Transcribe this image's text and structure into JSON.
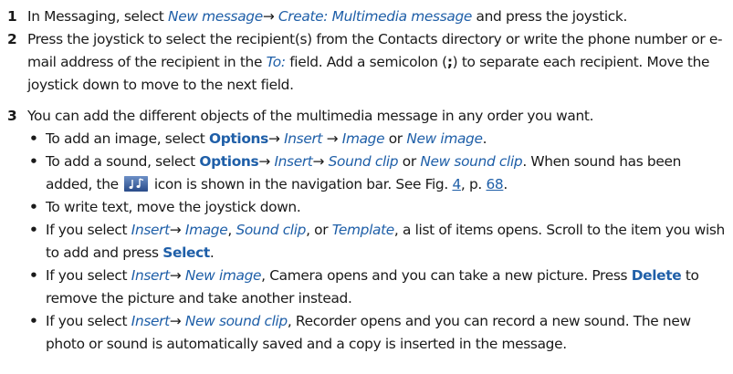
{
  "step1": {
    "num": "1",
    "t1": "In Messaging, select ",
    "ui1": "New message",
    "a1": "→ ",
    "ui2": "Create: Multimedia message",
    "t2": " and press the joystick."
  },
  "step2": {
    "num": "2",
    "t1": "Press the joystick to select the recipient(s) from the Contacts directory or write the phone number or e-mail address of the recipient in the ",
    "ui1": "To:",
    "t2": " field. Add a semicolon (",
    "semi": ";",
    "t3": ") to separate each recipient. Move the joystick down to move to the next field."
  },
  "step3": {
    "num": "3",
    "intro": "You can add the different objects of the multimedia message in any order you want.",
    "b1": {
      "t1": "To add an image, select ",
      "cmd1": "Options",
      "a1": "→ ",
      "ui1": "Insert",
      "a2": " → ",
      "ui2": "Image",
      "t2": " or ",
      "ui3": "New image",
      "t3": "."
    },
    "b2": {
      "t1": "To add a sound, select ",
      "cmd1": "Options",
      "a1": "→ ",
      "ui1": "Insert",
      "a2": "→ ",
      "ui2": "Sound clip",
      "t2": " or ",
      "ui3": "New sound clip",
      "t3": ". When sound has been added, the ",
      "t4": " icon is shown in the navigation bar. See Fig. ",
      "ref1": "4",
      "t5": ", p. ",
      "ref2": "68",
      "t6": "."
    },
    "b3": {
      "t1": "To write text, move the joystick down."
    },
    "b4": {
      "t1": "If you select ",
      "ui1": "Insert",
      "a1": "→ ",
      "ui2": "Image",
      "t2": ", ",
      "ui3": "Sound clip",
      "t3": ", or ",
      "ui4": "Template",
      "t4": ", a list of items opens. Scroll to the item you wish to add and press ",
      "cmd1": "Select",
      "t5": "."
    },
    "b5": {
      "t1": "If you select ",
      "ui1": "Insert",
      "a1": "→ ",
      "ui2": "New image",
      "t2": ", Camera opens and you can take a new picture. Press ",
      "cmd1": "Delete",
      "t3": " to remove the picture and take another instead."
    },
    "b6": {
      "t1": "If you select ",
      "ui1": "Insert",
      "a1": "→ ",
      "ui2": "New sound clip",
      "t2": ", Recorder opens and you can record a new sound. The new photo or sound is automatically saved and a copy is inserted in the message."
    }
  },
  "bullet": "•",
  "icons": {
    "sound": "music-note-icon"
  },
  "colors": {
    "link": "#1f5fa8",
    "icon_bg": "#3a5fa0"
  }
}
